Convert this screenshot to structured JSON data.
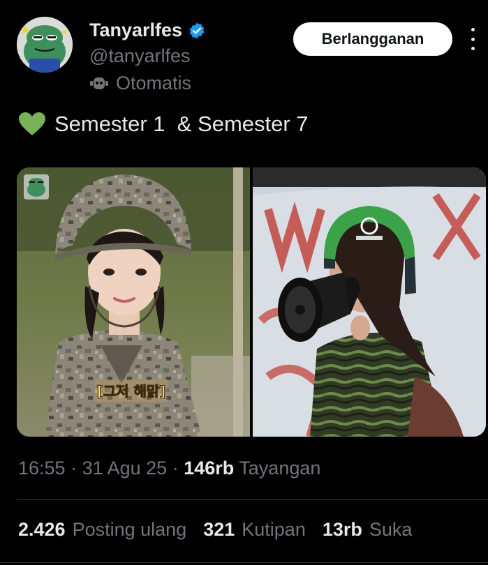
{
  "author": {
    "display_name": "Tanyarlfes",
    "handle": "@tanyarlfes",
    "automated_label": "Otomatis",
    "avatar_icon": "frog-avatar",
    "verified_icon": "verified-badge-icon"
  },
  "actions": {
    "subscribe_label": "Berlangganan",
    "more_icon": "more-options-icon"
  },
  "tweet": {
    "emoji": "green-heart-icon",
    "text": "Semester 1  & Semester 7"
  },
  "media": {
    "left_caption": "[그저 해맑]",
    "left_watermark_icon": "frog-watermark-icon"
  },
  "meta": {
    "time": "16:55",
    "separator": " · ",
    "date": "31 Agu 25",
    "views_count": "146rb",
    "views_label": "Tayangan"
  },
  "stats": {
    "reposts_count": "2.426",
    "reposts_label": "Posting ulang",
    "quotes_count": "321",
    "quotes_label": "Kutipan",
    "likes_count": "13rb",
    "likes_label": "Suka"
  },
  "colors": {
    "background": "#000000",
    "primary_text": "#e7e9ea",
    "secondary_text": "#71767b",
    "verified_blue": "#1d9bf0",
    "heart_green": "#78b159"
  }
}
